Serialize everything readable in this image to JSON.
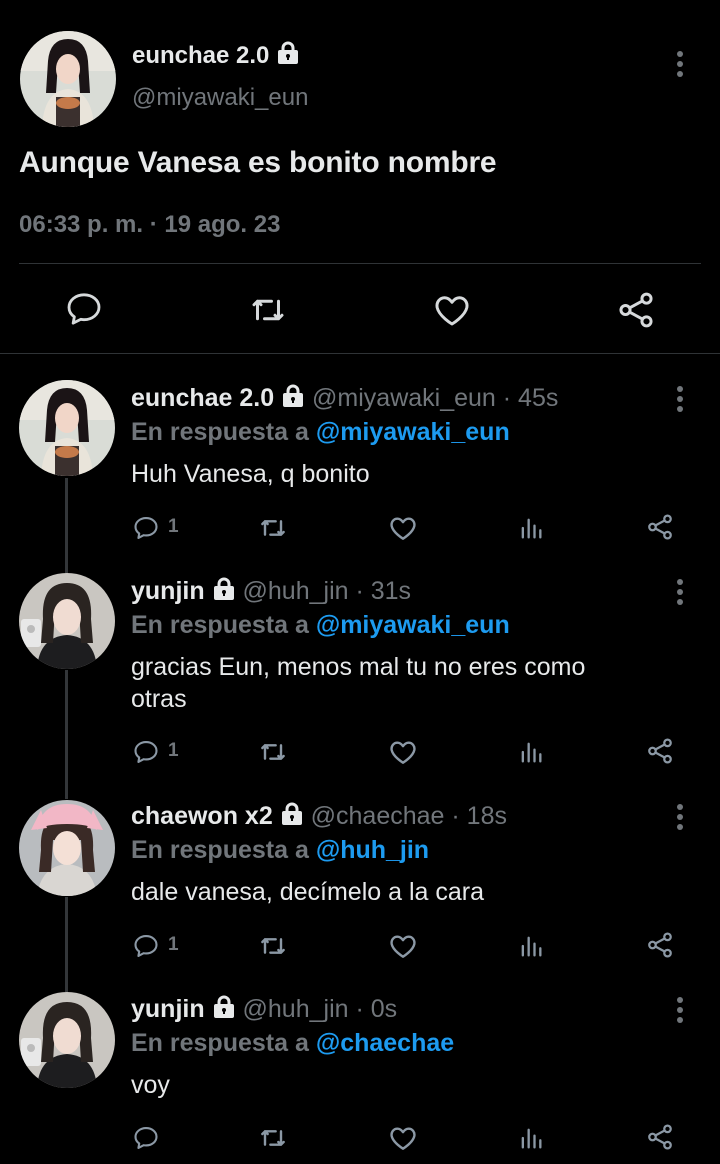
{
  "main_tweet": {
    "display_name": "eunchae 2.0",
    "handle": "@miyawaki_eun",
    "text": "Aunque Vanesa es bonito nombre",
    "timestamp": "06:33 p. m. · 19 ago. 23"
  },
  "replies": [
    {
      "display_name": "eunchae 2.0",
      "handle_time": "@miyawaki_eun · 45s",
      "reply_prefix": "En respuesta a",
      "reply_to": "@miyawaki_eun",
      "text": "Huh Vanesa, q bonito",
      "reply_count": "1"
    },
    {
      "display_name": "yunjin",
      "handle_time": "@huh_jin · 31s",
      "reply_prefix": "En respuesta a",
      "reply_to": "@miyawaki_eun",
      "text_line1": "gracias Eun, menos mal tu no eres como",
      "text_line2": "otras",
      "reply_count": "1"
    },
    {
      "display_name": "chaewon x2",
      "handle_time": "@chaechae · 18s",
      "reply_prefix": "En respuesta a",
      "reply_to": "@huh_jin",
      "text": "dale vanesa, decímelo a la cara",
      "reply_count": "1"
    },
    {
      "display_name": "yunjin",
      "handle_time": "@huh_jin · 0s",
      "reply_prefix": "En respuesta a",
      "reply_to": "@chaechae",
      "text": "voy"
    }
  ],
  "colors": {
    "background": "#000000",
    "text": "#e7e9ea",
    "muted": "#71767b",
    "link": "#1d9bf0",
    "divider": "#2f3336"
  },
  "icons": [
    "lock-icon",
    "more-icon",
    "reply-icon",
    "retweet-icon",
    "like-icon",
    "views-icon",
    "share-icon"
  ]
}
